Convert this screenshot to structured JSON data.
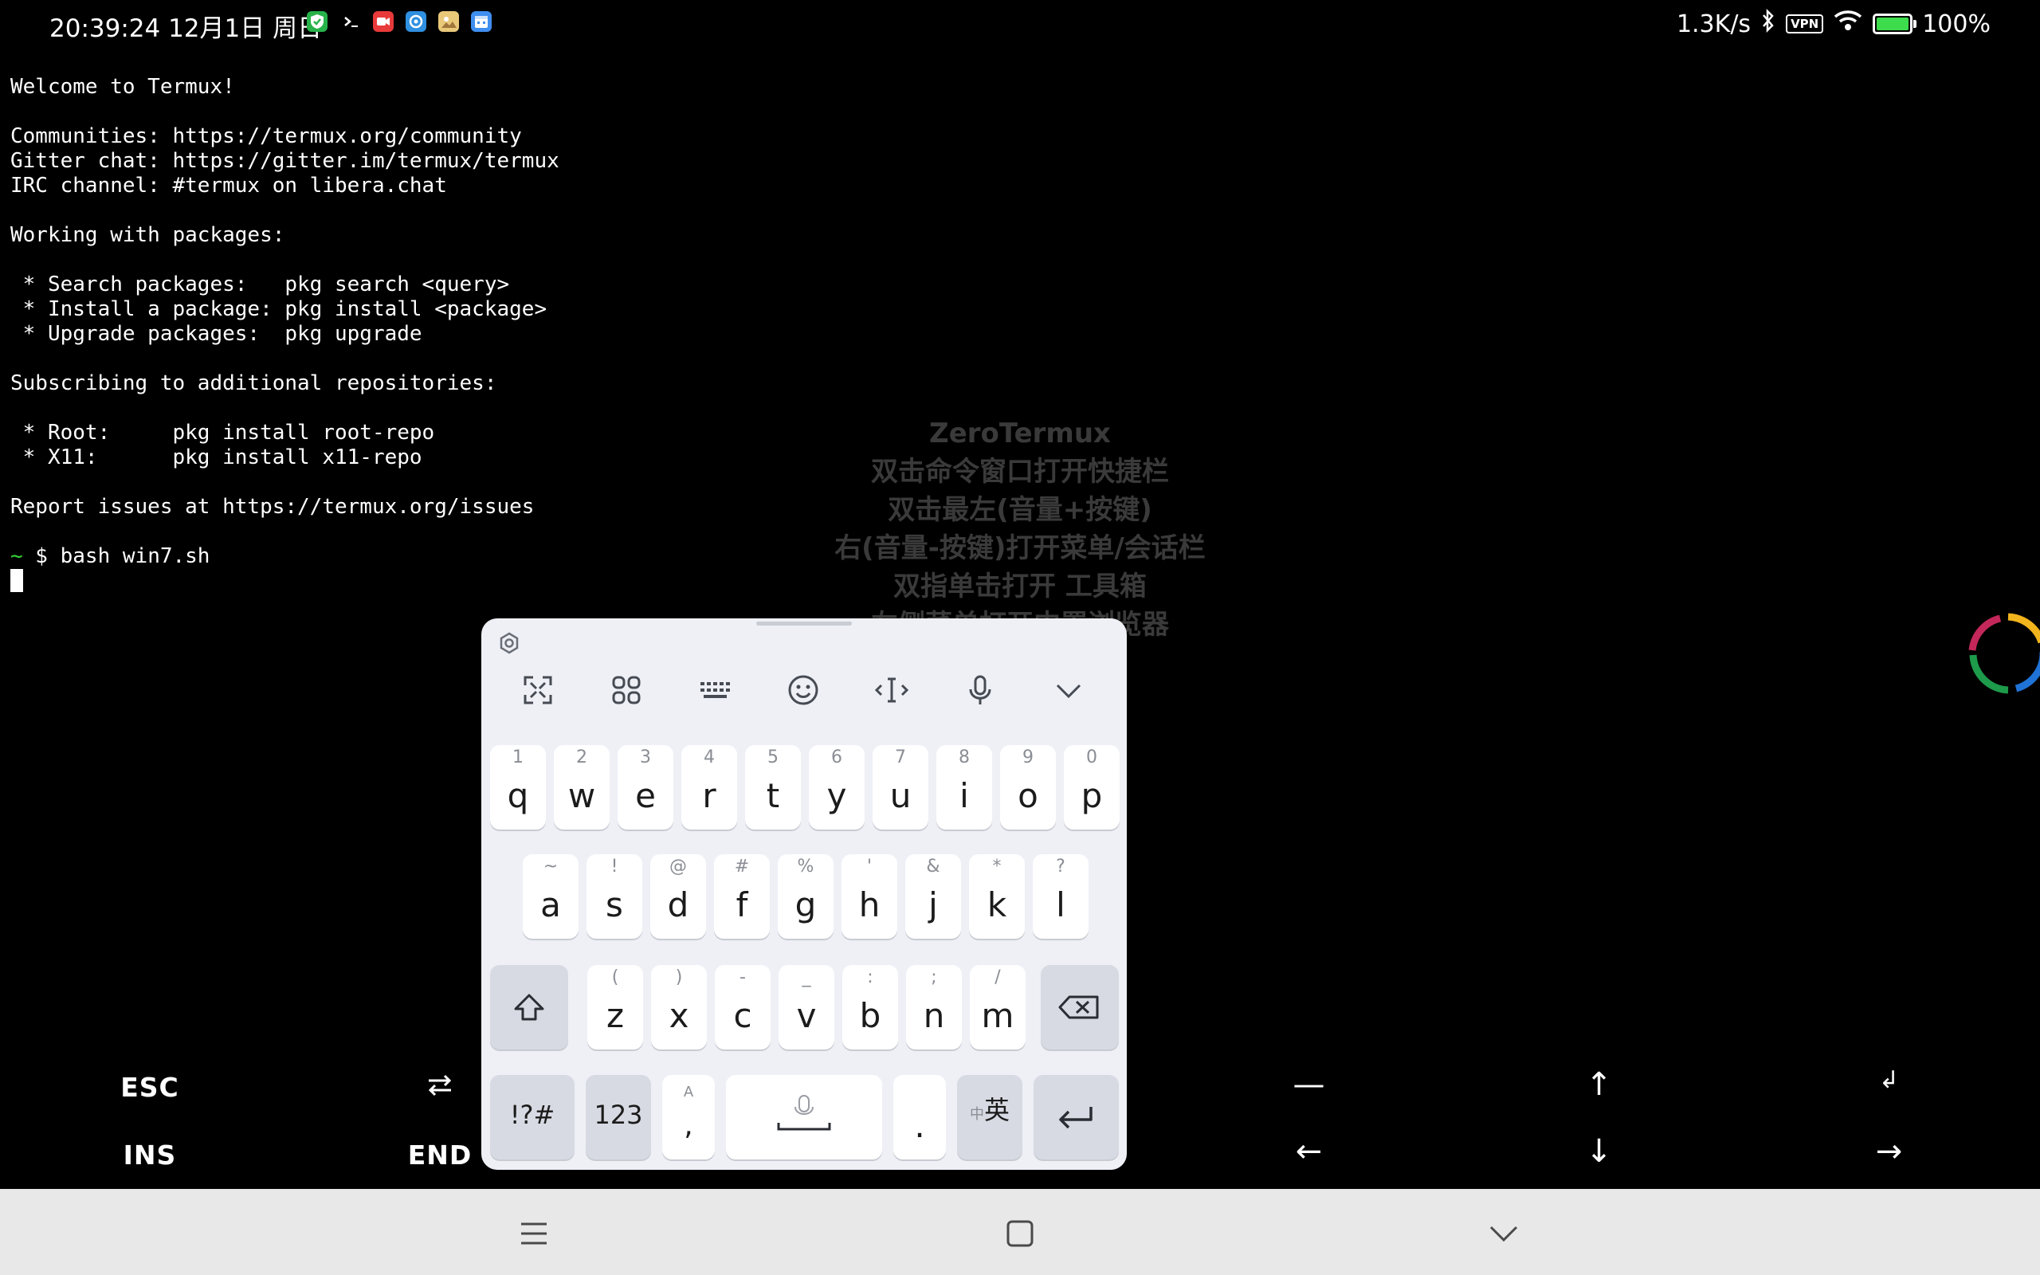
{
  "status_bar": {
    "time": "20:39:24 12月1日 周日",
    "net_speed": "1.3K/s",
    "vpn_label": "VPN",
    "battery_text": "100%",
    "battery_level": 1.0,
    "notification_icons": [
      "shield-icon",
      "terminal-icon",
      "video-icon",
      "browser-icon",
      "image-icon",
      "calendar-icon"
    ]
  },
  "terminal": {
    "lines": [
      "Welcome to Termux!",
      "",
      "Communities: https://termux.org/community",
      "Gitter chat: https://gitter.im/termux/termux",
      "IRC channel: #termux on libera.chat",
      "",
      "Working with packages:",
      "",
      " * Search packages:   pkg search <query>",
      " * Install a package: pkg install <package>",
      " * Upgrade packages:  pkg upgrade",
      "",
      "Subscribing to additional repositories:",
      "",
      " * Root:     pkg install root-repo",
      " * X11:      pkg install x11-repo",
      "",
      "Report issues at https://termux.org/issues",
      ""
    ],
    "prompt_tilde": "~",
    "prompt_command": " $ bash win7.sh"
  },
  "watermark": {
    "lines": [
      "ZeroTermux",
      "双击命令窗口打开快捷栏",
      "双击最左(音量+按键)",
      "右(音量-按键)打开菜单/会话栏",
      "双指单击打开 工具箱",
      "左侧菜单打开内置浏览器"
    ]
  },
  "extra_keys": {
    "esc": "ESC",
    "tab": "⭾",
    "ins": "INS",
    "end": "END",
    "dash": "—",
    "up": "↑",
    "enter": "↲",
    "left": "←",
    "down": "↓",
    "right": "→"
  },
  "keyboard": {
    "toolbar_icons": [
      "expand-icon",
      "apps-grid-icon",
      "keyboard-layout-icon",
      "emoji-icon",
      "cursor-move-icon",
      "microphone-icon",
      "collapse-chevron-icon"
    ],
    "row1": [
      {
        "main": "q",
        "sub": "1"
      },
      {
        "main": "w",
        "sub": "2"
      },
      {
        "main": "e",
        "sub": "3"
      },
      {
        "main": "r",
        "sub": "4"
      },
      {
        "main": "t",
        "sub": "5"
      },
      {
        "main": "y",
        "sub": "6"
      },
      {
        "main": "u",
        "sub": "7"
      },
      {
        "main": "i",
        "sub": "8"
      },
      {
        "main": "o",
        "sub": "9"
      },
      {
        "main": "p",
        "sub": "0"
      }
    ],
    "row2": [
      {
        "main": "a",
        "sub": "~"
      },
      {
        "main": "s",
        "sub": "!"
      },
      {
        "main": "d",
        "sub": "@"
      },
      {
        "main": "f",
        "sub": "#"
      },
      {
        "main": "g",
        "sub": "%"
      },
      {
        "main": "h",
        "sub": "'"
      },
      {
        "main": "j",
        "sub": "&"
      },
      {
        "main": "k",
        "sub": "*"
      },
      {
        "main": "l",
        "sub": "?"
      }
    ],
    "row3": [
      {
        "main": "z",
        "sub": "("
      },
      {
        "main": "x",
        "sub": ")"
      },
      {
        "main": "c",
        "sub": "-"
      },
      {
        "main": "v",
        "sub": "_"
      },
      {
        "main": "b",
        "sub": ":"
      },
      {
        "main": "n",
        "sub": ";"
      },
      {
        "main": "m",
        "sub": "/"
      }
    ],
    "symbols_label": "!?#",
    "numbers_label": "123",
    "comma_label": ",",
    "comma_sub": "A",
    "period_label": ".",
    "lang_small": "中",
    "lang_main": "英"
  },
  "nav_bar": {
    "icons": [
      "menu-icon",
      "home-icon",
      "back-chevron-icon"
    ]
  }
}
